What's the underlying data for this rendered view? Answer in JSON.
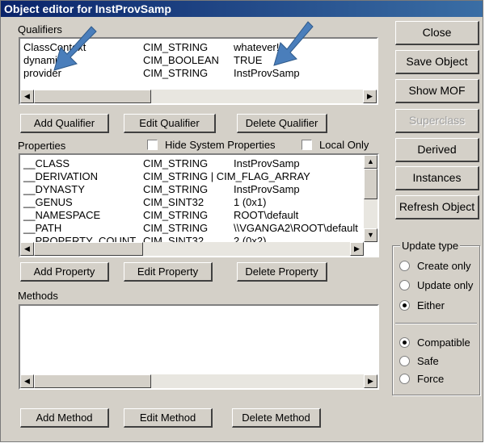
{
  "window": {
    "title": "Object editor for InstProvSamp"
  },
  "qualifiers": {
    "label": "Qualifiers",
    "rows": [
      {
        "name": "ClassContext",
        "type": "CIM_STRING",
        "value": "whatever!"
      },
      {
        "name": "dynamic",
        "type": "CIM_BOOLEAN",
        "value": "TRUE"
      },
      {
        "name": "provider",
        "type": "CIM_STRING",
        "value": "InstProvSamp"
      }
    ],
    "buttons": {
      "add": "Add Qualifier",
      "edit": "Edit Qualifier",
      "delete": "Delete Qualifier"
    }
  },
  "properties": {
    "label": "Properties",
    "hide_system_label": "Hide System Properties",
    "local_only_label": "Local Only",
    "hide_system_checked": false,
    "local_only_checked": false,
    "rows": [
      {
        "name": "__CLASS",
        "type": "CIM_STRING",
        "value": "InstProvSamp"
      },
      {
        "name": "__DERIVATION",
        "type": "CIM_STRING | CIM_FLAG_ARRAY",
        "value": ""
      },
      {
        "name": "__DYNASTY",
        "type": "CIM_STRING",
        "value": "InstProvSamp"
      },
      {
        "name": "__GENUS",
        "type": "CIM_SINT32",
        "value": "1 (0x1)"
      },
      {
        "name": "__NAMESPACE",
        "type": "CIM_STRING",
        "value": "ROOT\\default"
      },
      {
        "name": "__PATH",
        "type": "CIM_STRING",
        "value": "\\\\VGANGA2\\ROOT\\default"
      },
      {
        "name": "__PROPERTY_COUNT",
        "type": "CIM_SINT32",
        "value": "2 (0x2)"
      }
    ],
    "buttons": {
      "add": "Add Property",
      "edit": "Edit Property",
      "delete": "Delete Property"
    }
  },
  "methods": {
    "label": "Methods",
    "buttons": {
      "add": "Add Method",
      "edit": "Edit Method",
      "delete": "Delete Method"
    }
  },
  "side_buttons": {
    "close": "Close",
    "save": "Save Object",
    "show_mof": "Show MOF",
    "superclass": "Superclass",
    "derived": "Derived",
    "instances": "Instances",
    "refresh": "Refresh Object"
  },
  "update_type": {
    "title": "Update type",
    "options": [
      "Create only",
      "Update only",
      "Either"
    ],
    "selected": "Either"
  },
  "compat": {
    "options": [
      "Compatible",
      "Safe",
      "Force"
    ],
    "selected": "Compatible"
  },
  "colors": {
    "titlebar": "#0a246a",
    "face": "#d4d0c8",
    "arrow": "#4a7ebb"
  },
  "icons": {
    "scroll_left": "triangle-left",
    "scroll_right": "triangle-right",
    "scroll_up": "triangle-up",
    "scroll_down": "triangle-down",
    "callout": "blue-arrow"
  }
}
